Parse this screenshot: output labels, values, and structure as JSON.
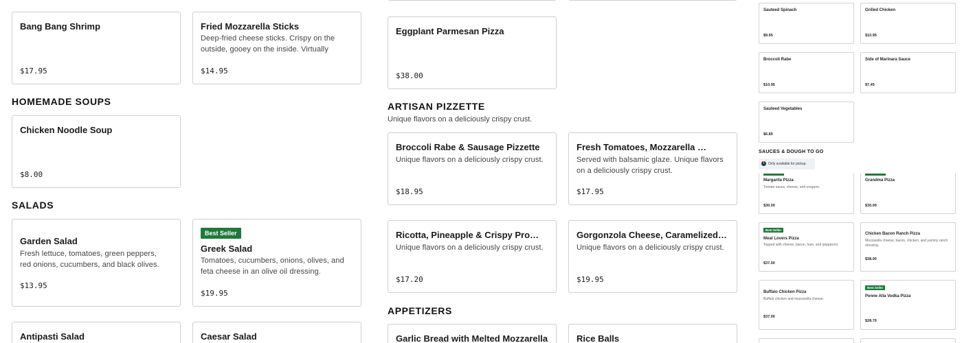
{
  "left_column": {
    "cards": [
      {
        "name": "Bang Bang Shrimp",
        "desc": "",
        "price": "$17.95"
      },
      {
        "name": "Fried Mozzarella Sticks",
        "desc": "Deep-fried cheese sticks. Crispy on the outside, gooey on the inside. Virtually guaranteed to be ...",
        "price": "$14.95"
      }
    ],
    "homemade_soups": {
      "title": "HOMEMADE SOUPS",
      "cards": [
        {
          "name": "Chicken Noodle Soup",
          "price": "$8.00"
        }
      ]
    },
    "salads": {
      "title": "SALADS",
      "cards": [
        {
          "name": "Garden Salad",
          "desc": "Fresh lettuce, tomatoes, green peppers, red onions, cucumbers, and black olives.",
          "price": "$13.95"
        },
        {
          "badge": "Best Seller",
          "name": "Greek Salad",
          "desc": "Tomatoes, cucumbers, onions, olives, and feta cheese in an olive oil dressing.",
          "price": "$19.95"
        },
        {
          "name": "Antipasti Salad"
        },
        {
          "name": "Caesar Salad"
        }
      ]
    }
  },
  "middle_column": {
    "top_card": {
      "name": "Eggplant Parmesan Pizza",
      "price": "$38.00"
    },
    "artisan_pizzette": {
      "title": "ARTISAN PIZZETTE",
      "subtitle": "Unique flavors on a deliciously crispy crust.",
      "cards": [
        {
          "name": "Broccoli Rabe & Sausage Pizzette",
          "desc": "Unique flavors on a deliciously crispy crust.",
          "price": "$18.95"
        },
        {
          "name": "Fresh Tomatoes, Mozzarella & Basil Pizzette",
          "desc": "Served with balsamic glaze. Unique flavors on a deliciously crispy crust.",
          "price": "$17.95"
        },
        {
          "name": "Ricotta, Pineapple & Crispy Prosciutto Pizzette",
          "desc": "Unique flavors on a deliciously crispy crust.",
          "price": "$17.20"
        },
        {
          "name": "Gorgonzola Cheese, Caramelized Onion & Pear Pizzette",
          "desc": "Unique flavors on a deliciously crispy crust.",
          "price": "$19.95"
        }
      ]
    },
    "appetizers": {
      "title": "APPETIZERS",
      "cards": [
        {
          "name": "Garlic Bread with Melted Mozzarella"
        },
        {
          "name": "Rice Balls"
        }
      ]
    }
  },
  "right_panel": {
    "sides": [
      {
        "name": "Sauteed Spinach",
        "price": "$9.95"
      },
      {
        "name": "Grilled Chicken",
        "price": "$10.95"
      },
      {
        "name": "Broccoli Rabe",
        "price": "$10.95"
      },
      {
        "name": "Side of Marinara Sauce",
        "price": "$7.45"
      },
      {
        "name": "Sauteed Vegetables",
        "price": "$6.85"
      }
    ],
    "sauces_section": {
      "title": "SAUCES & DOUGH TO GO",
      "pickup_note": "Only available for pickup"
    },
    "pizzas": [
      {
        "name": "Margarita Pizza",
        "desc": "Tomato sauce, cheese, and oregano.",
        "price": "$30.00"
      },
      {
        "name": "Grandma Pizza",
        "price": "$30.00"
      },
      {
        "badge": "Best Seller",
        "name": "Meat Lovers Pizza",
        "desc": "Topped with cheese, bacon, ham, and pepperoni.",
        "price": "$37.00"
      },
      {
        "name": "Chicken Bacon Ranch Pizza",
        "desc": "Mozzarella cheese, bacon, chicken, and yummy ranch dressing.",
        "price": "$38.00"
      },
      {
        "name": "Buffalo Chicken Pizza",
        "desc": "Buffalo chicken and mozzarella cheese.",
        "price": "$37.00"
      },
      {
        "badge": "Best Seller",
        "name": "Penne Alla Vodka Pizza",
        "price": "$28.70"
      }
    ]
  },
  "colors": {
    "badge_green": "#1f7a3a",
    "card_border": "#cfcfcf"
  }
}
